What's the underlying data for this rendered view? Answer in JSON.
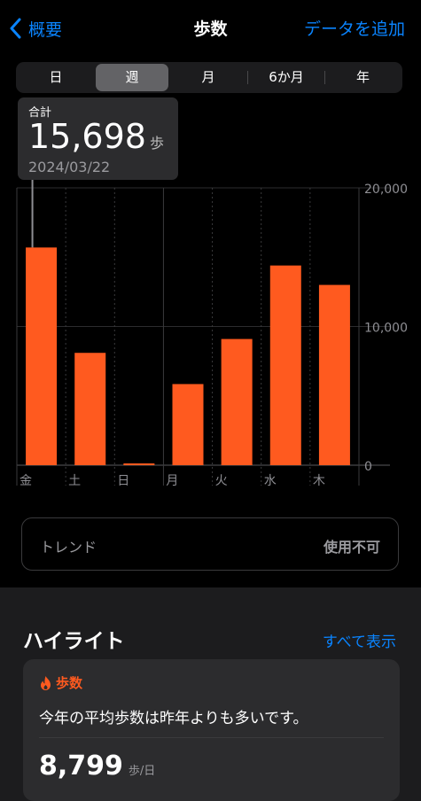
{
  "nav": {
    "back_label": "概要",
    "title": "歩数",
    "action_label": "データを追加"
  },
  "segments": [
    {
      "label": "日",
      "selected": false
    },
    {
      "label": "週",
      "selected": true
    },
    {
      "label": "月",
      "selected": false
    },
    {
      "label": "6か月",
      "selected": false
    },
    {
      "label": "年",
      "selected": false
    }
  ],
  "tooltip": {
    "label": "合計",
    "value": "15,698",
    "unit": "歩",
    "date": "2024/03/22"
  },
  "chart_data": {
    "type": "bar",
    "categories": [
      "金",
      "土",
      "日",
      "月",
      "火",
      "水",
      "木"
    ],
    "values": [
      15698,
      8100,
      100,
      5850,
      9100,
      14400,
      13000
    ],
    "y_ticks": [
      "0",
      "10,000",
      "20,000"
    ],
    "ylim": [
      0,
      20000
    ],
    "bar_color": "#ff5a1f",
    "selected_index": 0
  },
  "trend": {
    "label": "トレンド",
    "value": "使用不可"
  },
  "highlights": {
    "title": "ハイライト",
    "show_all_label": "すべて表示",
    "card": {
      "category": "歩数",
      "text": "今年の平均歩数は昨年よりも多いです。",
      "number": "8,799",
      "unit": "歩/日"
    }
  }
}
